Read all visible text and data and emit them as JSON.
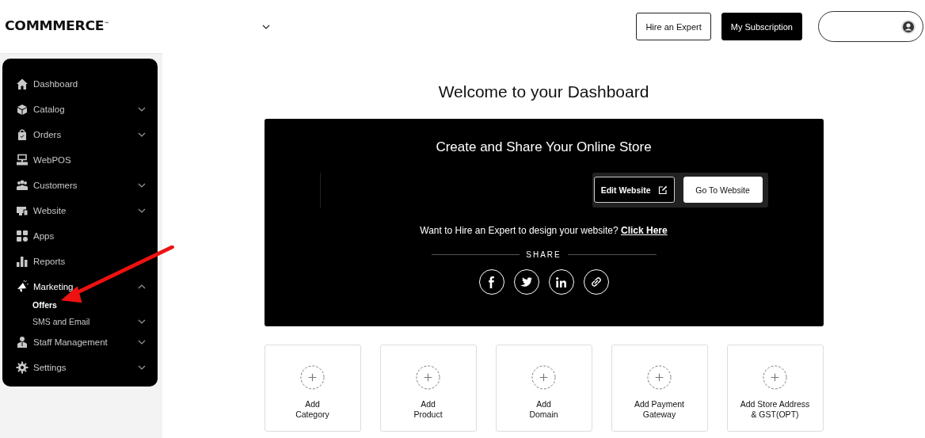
{
  "header": {
    "logo": "COMMMERCE$^{™}$",
    "buttons": [
      {
        "label": "Hire an Expert",
        "kind": "outline"
      },
      {
        "label": "My Subscription",
        "kind": "solid"
      }
    ]
  },
  "sidebar": {
    "items": [
      {
        "label": "Dashboard",
        "kind": "home",
        "expandable": false,
        "expanded": false
      },
      {
        "label": "Catalog",
        "kind": "box",
        "expandable": true,
        "expanded": false
      },
      {
        "label": "Orders",
        "kind": "bag",
        "expandable": true,
        "expanded": false
      },
      {
        "label": "WebPOS",
        "kind": "pos",
        "expandable": false,
        "expanded": false
      },
      {
        "label": "Customers",
        "kind": "users",
        "expandable": true,
        "expanded": false
      },
      {
        "label": "Website",
        "kind": "monitor",
        "expandable": true,
        "expanded": false
      },
      {
        "label": "Apps",
        "kind": "apps",
        "expandable": false,
        "expanded": false
      },
      {
        "label": "Reports",
        "kind": "chart",
        "expandable": false,
        "expanded": false
      },
      {
        "label": "Marketing",
        "kind": "megaphone",
        "expandable": true,
        "expanded": true,
        "children": [
          {
            "label": "Offers",
            "selected": true,
            "expandable": false
          },
          {
            "label": "SMS and Email",
            "selected": false,
            "expandable": true
          }
        ]
      },
      {
        "label": "Staff Management",
        "kind": "staff",
        "expandable": true,
        "expanded": false
      },
      {
        "label": "Settings",
        "kind": "gear",
        "expandable": true,
        "expanded": false
      }
    ]
  },
  "main": {
    "title": "Welcome to your Dashboard",
    "banner": {
      "title": "Create and Share Your Online Store",
      "buttons": [
        {
          "label": "Edit Website",
          "kind": "outline"
        },
        {
          "label": "Go To Website",
          "kind": "solid"
        }
      ],
      "hire_text": "Want to Hire an Expert to design your website?",
      "hire_link": "Click Here",
      "share_label": "SHARE",
      "share_icons": [
        {
          "kind": "facebook"
        },
        {
          "kind": "twitter"
        },
        {
          "kind": "linkedin"
        },
        {
          "kind": "link"
        }
      ]
    },
    "cards": [
      {
        "lines": [
          "Add",
          "Category"
        ]
      },
      {
        "lines": [
          "Add",
          "Product"
        ]
      },
      {
        "lines": [
          "Add",
          "Domain"
        ]
      },
      {
        "lines": [
          "Add Payment",
          "Gateway"
        ]
      },
      {
        "lines": [
          "Add Store Address",
          "& GST(OPT)"
        ]
      }
    ]
  }
}
